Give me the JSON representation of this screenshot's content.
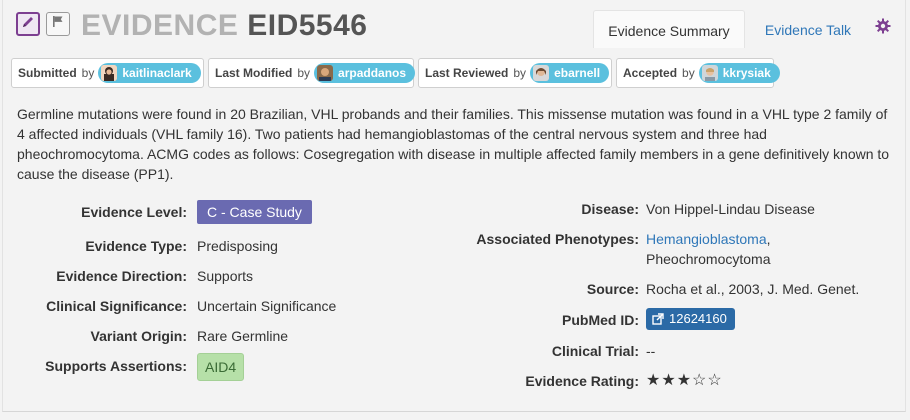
{
  "header": {
    "title_prefix": "EVIDENCE",
    "title_id": "EID5546",
    "edit_icon": "pencil-icon",
    "flag_icon": "flag-icon"
  },
  "tabs": {
    "summary_label": "Evidence Summary",
    "talk_label": "Evidence Talk",
    "settings_icon": "gear-icon"
  },
  "attribution": [
    {
      "label": "Submitted",
      "by": "by",
      "user": "kaitlinaclark"
    },
    {
      "label": "Last Modified",
      "by": "by",
      "user": "arpaddanos"
    },
    {
      "label": "Last Reviewed",
      "by": "by",
      "user": "ebarnell"
    },
    {
      "label": "Accepted",
      "by": "by",
      "user": "kkrysiak"
    }
  ],
  "description": "Germline mutations were found in 20 Brazilian, VHL probands and their families. This missense mutation was found in a VHL type 2 family of 4 affected individuals (VHL family 16). Two patients had hemangioblastomas of the central nervous system and three had pheochromocytoma. ACMG codes as follows: Cosegregation with disease in multiple affected family members in a gene definitively known to cause the disease (PP1).",
  "left": {
    "evidence_level_label": "Evidence Level:",
    "evidence_level_value": "C - Case Study",
    "evidence_type_label": "Evidence Type:",
    "evidence_type_value": "Predisposing",
    "evidence_direction_label": "Evidence Direction:",
    "evidence_direction_value": "Supports",
    "clinical_significance_label": "Clinical Significance:",
    "clinical_significance_value": "Uncertain Significance",
    "variant_origin_label": "Variant Origin:",
    "variant_origin_value": "Rare Germline",
    "supports_assertions_label": "Supports Assertions:",
    "supports_assertions_value": "AID4"
  },
  "right": {
    "disease_label": "Disease:",
    "disease_value": "Von Hippel-Lindau Disease",
    "phenotypes_label": "Associated Phenotypes:",
    "phenotype_1": "Hemangioblastoma",
    "phenotype_sep": ",",
    "phenotype_2": "Pheochromocytoma",
    "source_label": "Source:",
    "source_value": "Rocha et al., 2003, J. Med. Genet.",
    "pubmed_label": "PubMed ID:",
    "pubmed_value": "12624160",
    "clinical_trial_label": "Clinical Trial:",
    "clinical_trial_value": "--",
    "rating_label": "Evidence Rating:",
    "rating_value": 3,
    "rating_max": 5
  },
  "colors": {
    "accent_purple": "#7d3f91",
    "link_blue": "#2f77b8",
    "pill_blue": "#5bc0de",
    "level_purple": "#6a6ab1",
    "assertion_green": "#b6e0a8"
  }
}
